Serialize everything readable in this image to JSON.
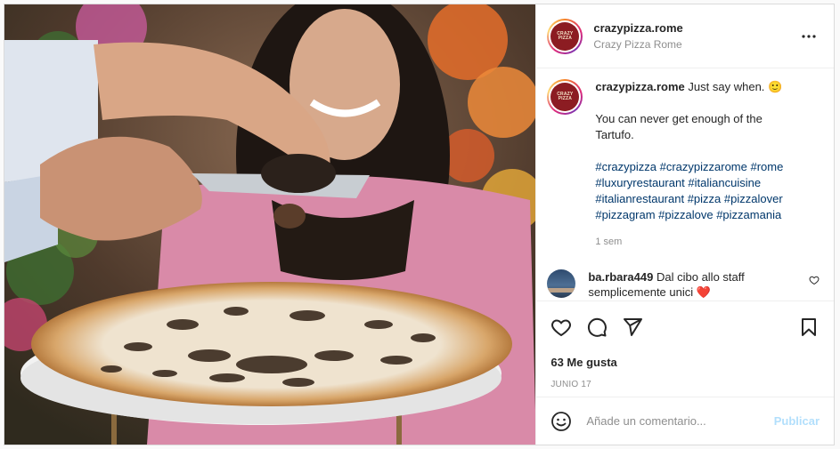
{
  "post": {
    "account": {
      "username": "crazypizza.rome",
      "display_name": "Crazy Pizza Rome",
      "avatar_text": "CRAZY PIZZA",
      "more_icon": "ellipsis-icon"
    },
    "caption": {
      "username": "crazypizza.rome",
      "line1": "Just say when. 🙂",
      "line2": "You can never get enough of the Tartufo.",
      "hashtags": "#crazypizza #crazypizzarome #rome #luxuryrestaurant #italiancuisine #italianrestaurant #pizza #pizzalover #pizzagram #pizzalove #pizzamania",
      "time_ago": "1 sem"
    },
    "comments": [
      {
        "username": "ba.rbara449",
        "text": "Dal cibo allo staff semplicemente unici ❤️"
      }
    ],
    "actions": {
      "like_icon": "heart-icon",
      "comment_icon": "comment-icon",
      "share_icon": "paper-plane-icon",
      "save_icon": "bookmark-icon"
    },
    "likes_text": "63 Me gusta",
    "date_text": "JUNIO 17",
    "composer": {
      "placeholder": "Añade un comentario...",
      "publish_label": "Publicar"
    }
  },
  "colors": {
    "link": "#00376b",
    "publish_disabled": "#b2dffc",
    "muted": "#8e8e8e",
    "brand": "#8c1c22"
  }
}
